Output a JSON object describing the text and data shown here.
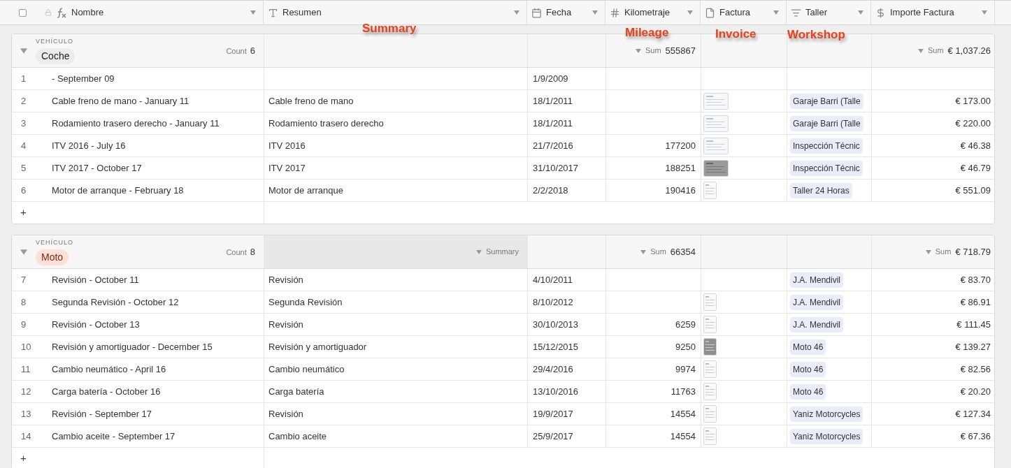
{
  "header": {
    "select_all": {
      "checked": false
    },
    "columns": [
      {
        "kind": "formula",
        "label": "Nombre"
      },
      {
        "kind": "text",
        "label": "Resumen"
      },
      {
        "kind": "date",
        "label": "Fecha"
      },
      {
        "kind": "number",
        "label": "Kilometraje"
      },
      {
        "kind": "attachment",
        "label": "Factura"
      },
      {
        "kind": "link",
        "label": "Taller"
      },
      {
        "kind": "currency",
        "label": "Importe Factura"
      }
    ]
  },
  "annotations": [
    "Summary",
    "Mileage",
    "Invoice",
    "Workshop"
  ],
  "groups": [
    {
      "field": "VEHÍCULO",
      "tag": "Coche",
      "color": "#ececec",
      "count_label": "Count",
      "count": "6",
      "km_sum": {
        "label": "Sum",
        "value": "555867"
      },
      "importe_sum": {
        "label": "Sum",
        "value": "€ 1,037.26"
      },
      "add": "+",
      "rows": [
        {
          "n": "1",
          "nombre": "- September 09",
          "fecha": "1/9/2009"
        },
        {
          "n": "2",
          "nombre": "Cable freno de mano - January 11",
          "resumen": "Cable freno de mano",
          "fecha": "18/1/2011",
          "attachment": {
            "kind": "landscape"
          },
          "taller": "Garaje Barri (Talle",
          "importe": "€ 173.00"
        },
        {
          "n": "3",
          "nombre": "Rodamiento trasero derecho - January 11",
          "resumen": "Rodamiento trasero derecho",
          "fecha": "18/1/2011",
          "attachment": {
            "kind": "landscape"
          },
          "taller": "Garaje Barri (Talle",
          "importe": "€ 220.00"
        },
        {
          "n": "4",
          "nombre": "ITV 2016 - July 16",
          "resumen": "ITV 2016",
          "fecha": "21/7/2016",
          "km": "177200",
          "attachment": {
            "kind": "landscape"
          },
          "taller": "Inspección Técnic",
          "importe": "€ 46.38"
        },
        {
          "n": "5",
          "nombre": "ITV 2017 - October 17",
          "resumen": "ITV 2017",
          "fecha": "31/10/2017",
          "km": "188251",
          "attachment": {
            "kind": "dark"
          },
          "taller": "Inspección Técnic",
          "importe": "€ 46.79"
        },
        {
          "n": "6",
          "nombre": "Motor de arranque - February 18",
          "resumen": "Motor de arranque",
          "fecha": "2/2/2018",
          "km": "190416",
          "attachment": {
            "kind": "portrait"
          },
          "taller": "Taller 24 Horas",
          "importe": "€ 551.09"
        }
      ]
    },
    {
      "field": "VEHÍCULO",
      "tag": "Moto",
      "color": "#fde0d6",
      "count_label": "Count",
      "count": "8",
      "summary_hint": "Summary",
      "km_sum": {
        "label": "Sum",
        "value": "66354"
      },
      "importe_sum": {
        "label": "Sum",
        "value": "€ 718.79"
      },
      "add": "+",
      "rows": [
        {
          "n": "7",
          "nombre": "Revisión - October 11",
          "resumen": "Revisión",
          "fecha": "4/10/2011",
          "taller": "J.A. Mendivil",
          "importe": "€ 83.70"
        },
        {
          "n": "8",
          "nombre": "Segunda Revisión - October 12",
          "resumen": "Segunda Revisión",
          "fecha": "8/10/2012",
          "attachment": {
            "kind": "portrait"
          },
          "taller": "J.A. Mendivil",
          "importe": "€ 86.91"
        },
        {
          "n": "9",
          "nombre": "Revisión - October 13",
          "resumen": "Revisión",
          "fecha": "30/10/2013",
          "km": "6259",
          "attachment": {
            "kind": "portrait"
          },
          "taller": "J.A. Mendivil",
          "importe": "€ 111.45"
        },
        {
          "n": "10",
          "nombre": "Revisión y amortiguador - December 15",
          "resumen": "Revisión y amortiguador",
          "fecha": "15/12/2015",
          "km": "9250",
          "attachment": {
            "kind": "portrait_dark"
          },
          "taller": "Moto 46",
          "importe": "€ 139.27"
        },
        {
          "n": "11",
          "nombre": "Cambio neumático - April 16",
          "resumen": "Cambio neumático",
          "fecha": "29/4/2016",
          "km": "9974",
          "attachment": {
            "kind": "portrait"
          },
          "taller": "Moto 46",
          "importe": "€ 82.56"
        },
        {
          "n": "12",
          "nombre": "Carga batería - October 16",
          "resumen": "Carga batería",
          "fecha": "13/10/2016",
          "km": "11763",
          "attachment": {
            "kind": "portrait"
          },
          "taller": "Moto 46",
          "importe": "€ 20.20"
        },
        {
          "n": "13",
          "nombre": "Revisión - September 17",
          "resumen": "Revisión",
          "fecha": "19/9/2017",
          "km": "14554",
          "attachment": {
            "kind": "portrait"
          },
          "taller": "Yaniz Motorcycles",
          "importe": "€ 127.34"
        },
        {
          "n": "14",
          "nombre": "Cambio aceite - September 17",
          "resumen": "Cambio aceite",
          "fecha": "25/9/2017",
          "km": "14554",
          "attachment": {
            "kind": "portrait"
          },
          "taller": "Yaniz Motorcycles",
          "importe": "€ 67.36"
        }
      ]
    }
  ]
}
